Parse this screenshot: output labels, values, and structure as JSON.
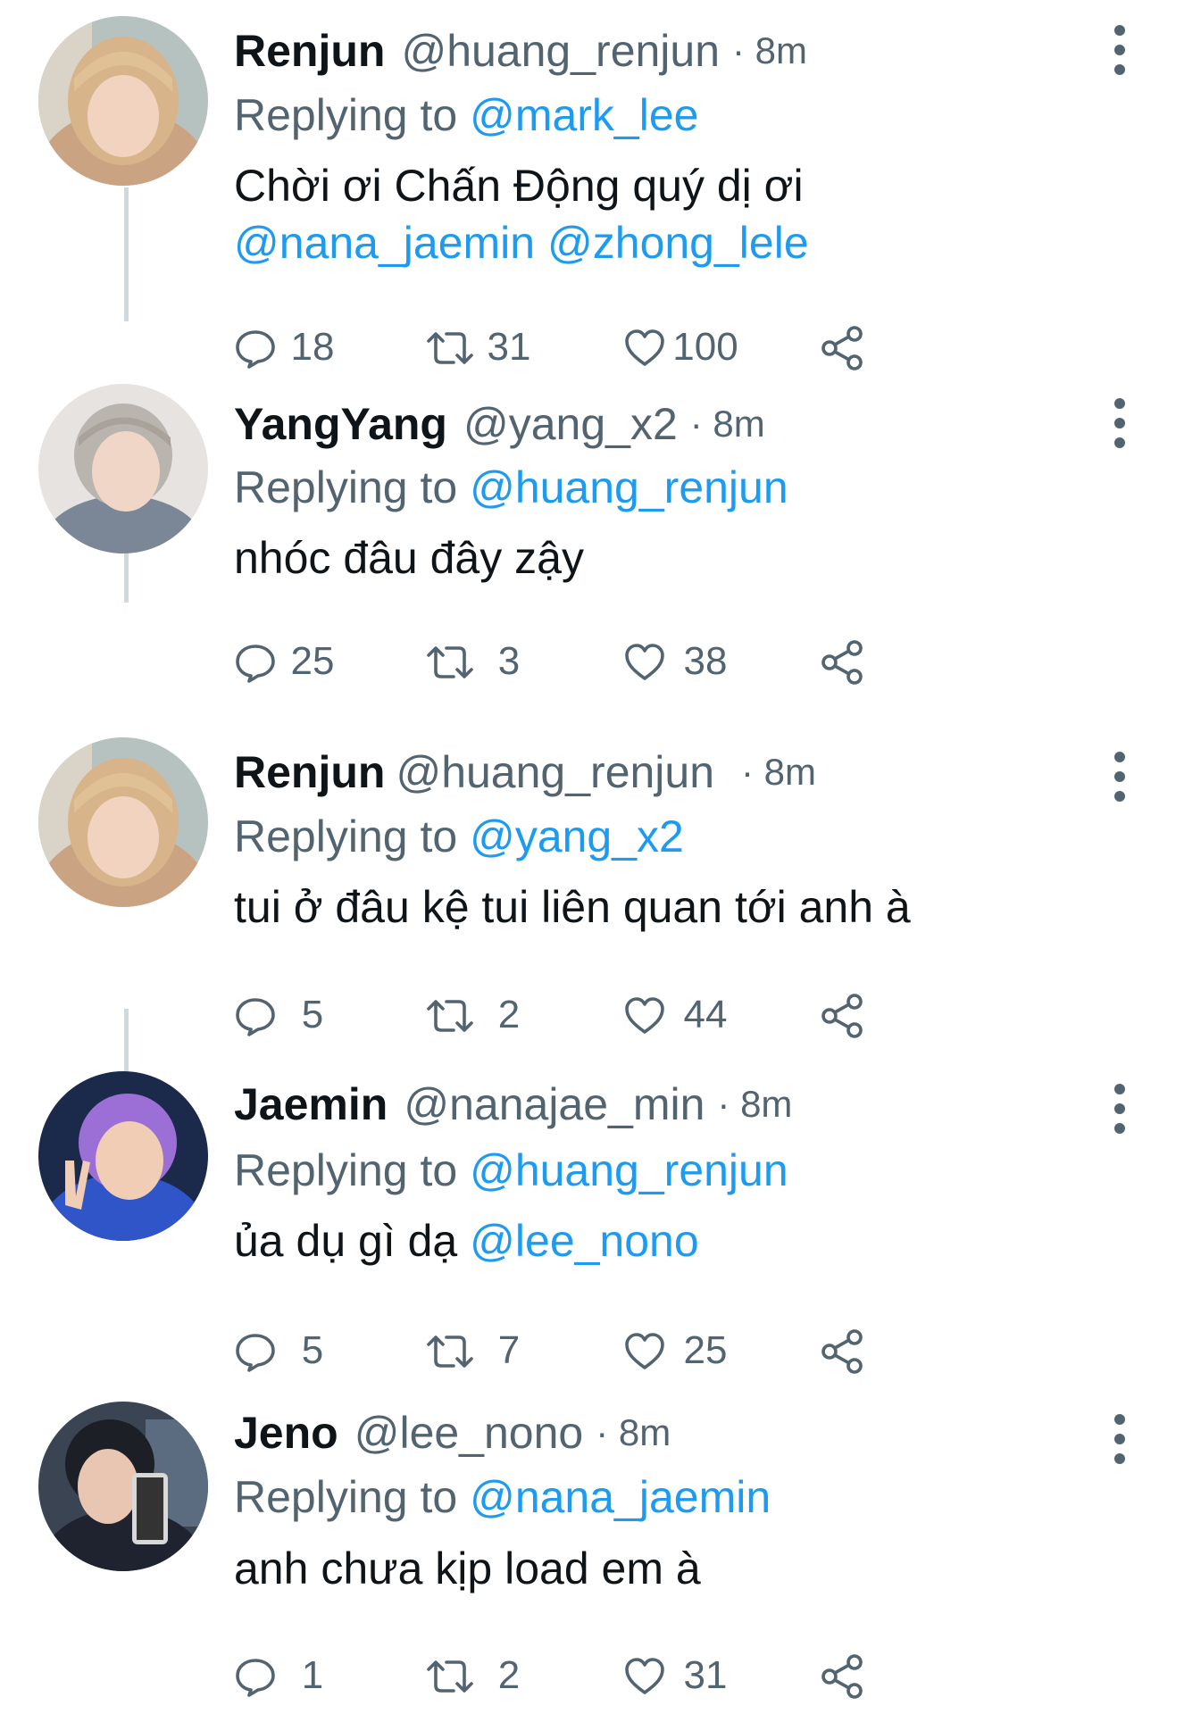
{
  "tweets": [
    {
      "name": "Renjun",
      "handle": "@huang_renjun",
      "time": "· 8m",
      "replying_prefix": "Replying to",
      "replying_to": "@mark_lee",
      "body_line1": "Chời ơi Chấn Động quý dị ơi",
      "body_mention1": "@nana_jaemin",
      "body_mention2": "@zhong_lele",
      "replies": "18",
      "retweets": "31",
      "likes": "100",
      "avatar_colors": {
        "bg": "#c7a287",
        "hair": "#d8b48a",
        "skin": "#f1d3c0",
        "hood": "#caa383"
      }
    },
    {
      "name": "YangYang",
      "handle": "@yang_x2",
      "time": "· 8m",
      "replying_prefix": "Replying to",
      "replying_to": "@huang_renjun",
      "body": "nhóc đâu đây zậy",
      "replies": "25",
      "retweets": "3",
      "likes": "38",
      "avatar_colors": {
        "bg": "#d9d6d3",
        "hair": "#b9b4ae",
        "skin": "#f0d6c6",
        "hood": "#7b8796"
      }
    },
    {
      "name": "Renjun",
      "handle": "@huang_renjun",
      "time": "· 8m",
      "replying_prefix": "Replying to",
      "replying_to": "@yang_x2",
      "body": "tui ở đâu kệ tui liên quan tới anh à",
      "replies": "5",
      "retweets": "2",
      "likes": "44",
      "avatar_colors": {
        "bg": "#c7a287",
        "hair": "#d8b48a",
        "skin": "#f1d3c0",
        "hood": "#caa383"
      }
    },
    {
      "name": "Jaemin",
      "handle": "@nanajae_min",
      "time": "· 8m",
      "replying_prefix": "Replying to",
      "replying_to": "@huang_renjun",
      "body": "ủa dụ gì dạ",
      "body_mention": "@lee_nono",
      "replies": "5",
      "retweets": "7",
      "likes": "25",
      "avatar_colors": {
        "bg": "#1b2a4a",
        "hair": "#9b6fd6",
        "skin": "#f2cdb6",
        "hood": "#2f55c9"
      }
    },
    {
      "name": "Jeno",
      "handle": "@lee_nono",
      "time": "· 8m",
      "replying_prefix": "Replying to",
      "replying_to": "@nana_jaemin",
      "body": "anh chưa kịp load em à",
      "replies": "1",
      "retweets": "2",
      "likes": "31",
      "avatar_colors": {
        "bg": "#3a4452",
        "hair": "#1c1f26",
        "skin": "#e8c6b2",
        "hood": "#1f2330"
      }
    }
  ],
  "colors": {
    "text": "#0f1419",
    "muted": "#536471",
    "link": "#1d9bf0",
    "thread_line": "#cfd9de"
  },
  "icons": {
    "reply": "reply-icon",
    "retweet": "retweet-icon",
    "like": "heart-icon",
    "share": "share-icon",
    "more": "more-vertical-icon"
  }
}
